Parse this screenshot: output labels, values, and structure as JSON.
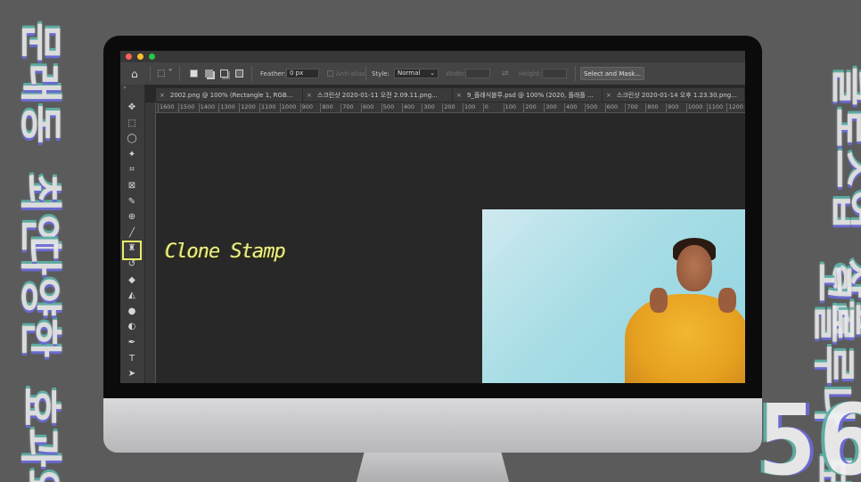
{
  "background": {
    "left_top": "문래동 최인",
    "left_bottom": "다양한 효과와 함께",
    "right_top": "클로즈업 상품",
    "right_mid": "코롤루나 보",
    "big_number": "56"
  },
  "titlebar": {
    "dots": [
      "#ff5f57",
      "#febc2e",
      "#28c840"
    ]
  },
  "options_bar": {
    "feather_label": "Feather:",
    "feather_value": "0 px",
    "anti_alias_label": "Anti-alias",
    "style_label": "Style:",
    "style_value": "Normal",
    "width_label": "Width:",
    "height_label": "Height:",
    "select_mask_label": "Select and Mask..."
  },
  "tabs": [
    {
      "label": "2002.png @ 100% (Rectangle 1, RGB..."
    },
    {
      "label": "스크린샷 2020-01-11 오전 2.09.11.png..."
    },
    {
      "label": "9_플래식블루.psd @ 100% (2020, 플래플 ..."
    },
    {
      "label": "스크린샷 2020-01-14 오후 1.23.30.png..."
    }
  ],
  "ruler_top": [
    "1600",
    "1500",
    "1400",
    "1300",
    "1200",
    "1100",
    "1000",
    "900",
    "800",
    "700",
    "600",
    "500",
    "400",
    "300",
    "200",
    "100",
    "0",
    "100",
    "200",
    "300",
    "400",
    "500",
    "600",
    "700",
    "800",
    "900",
    "1000",
    "1100",
    "1200"
  ],
  "tools": [
    {
      "name": "move-tool-icon",
      "glyph": "✥"
    },
    {
      "name": "marquee-tool-icon",
      "glyph": "⬚"
    },
    {
      "name": "lasso-tool-icon",
      "glyph": "◯"
    },
    {
      "name": "magic-wand-tool-icon",
      "glyph": "✦"
    },
    {
      "name": "crop-tool-icon",
      "glyph": "⌗"
    },
    {
      "name": "frame-tool-icon",
      "glyph": "⊠"
    },
    {
      "name": "eyedropper-tool-icon",
      "glyph": "✎"
    },
    {
      "name": "healing-brush-tool-icon",
      "glyph": "⊕"
    },
    {
      "name": "brush-tool-icon",
      "glyph": "╱"
    },
    {
      "name": "clone-stamp-tool-icon",
      "glyph": "♜"
    },
    {
      "name": "history-brush-tool-icon",
      "glyph": "↺"
    },
    {
      "name": "eraser-tool-icon",
      "glyph": "◆"
    },
    {
      "name": "paint-bucket-tool-icon",
      "glyph": "◭"
    },
    {
      "name": "blur-tool-icon",
      "glyph": "●"
    },
    {
      "name": "dodge-tool-icon",
      "glyph": "◐"
    },
    {
      "name": "pen-tool-icon",
      "glyph": "✒"
    },
    {
      "name": "type-tool-icon",
      "glyph": "T"
    },
    {
      "name": "path-selection-tool-icon",
      "glyph": "➤"
    }
  ],
  "overlay_label": "Clone Stamp"
}
